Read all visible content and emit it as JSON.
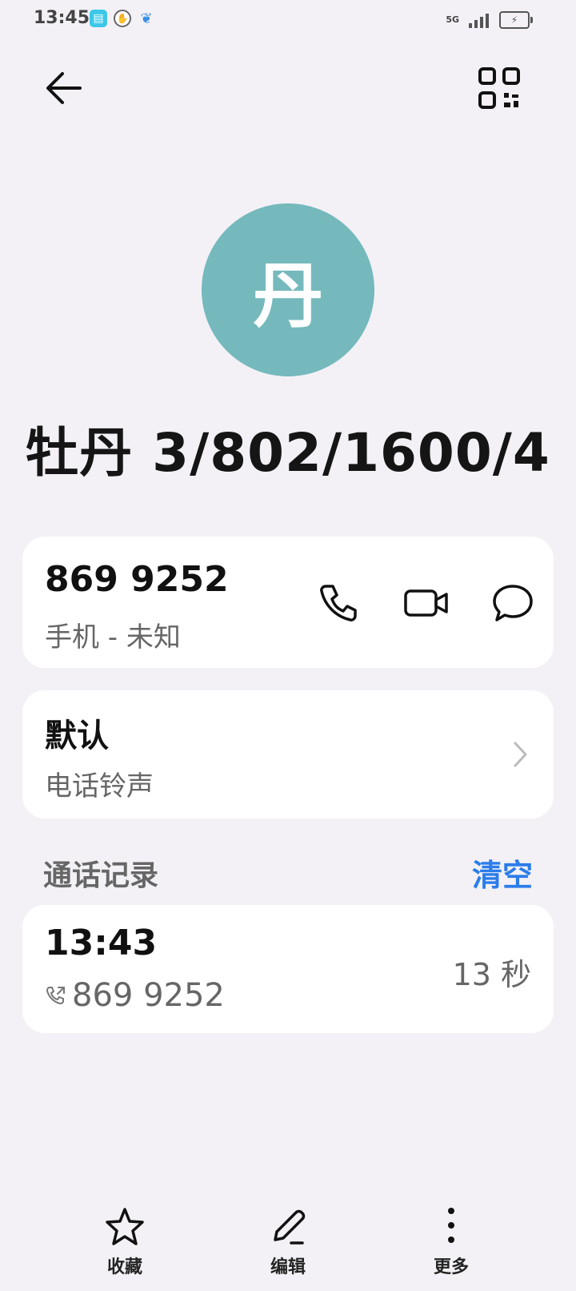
{
  "status_bar": {
    "time": "13:45",
    "network": "5G",
    "icons": [
      "book-icon",
      "hand-icon",
      "bird-icon",
      "signal-icon",
      "battery-icon"
    ]
  },
  "header": {
    "back_icon": "arrow-left-icon",
    "qr_icon": "qr-code-icon"
  },
  "contact": {
    "avatar_initial": "丹",
    "avatar_color": "#75b9bd",
    "name": "牡丹 3/802/1600/4"
  },
  "phone_card": {
    "number": "869 9252",
    "type": "手机 - 未知",
    "actions": [
      "phone-icon",
      "video-call-icon",
      "message-icon"
    ]
  },
  "ringtone_card": {
    "value": "默认",
    "label": "电话铃声"
  },
  "call_log": {
    "title": "通话记录",
    "clear_label": "清空",
    "accent_color": "#2b7de9",
    "entries": [
      {
        "time": "13:43",
        "number": "869 9252",
        "duration": "13 秒"
      }
    ]
  },
  "bottom_nav": {
    "items": [
      {
        "label": "收藏",
        "icon": "star-icon"
      },
      {
        "label": "编辑",
        "icon": "pencil-icon"
      },
      {
        "label": "更多",
        "icon": "more-vertical-icon"
      }
    ]
  }
}
